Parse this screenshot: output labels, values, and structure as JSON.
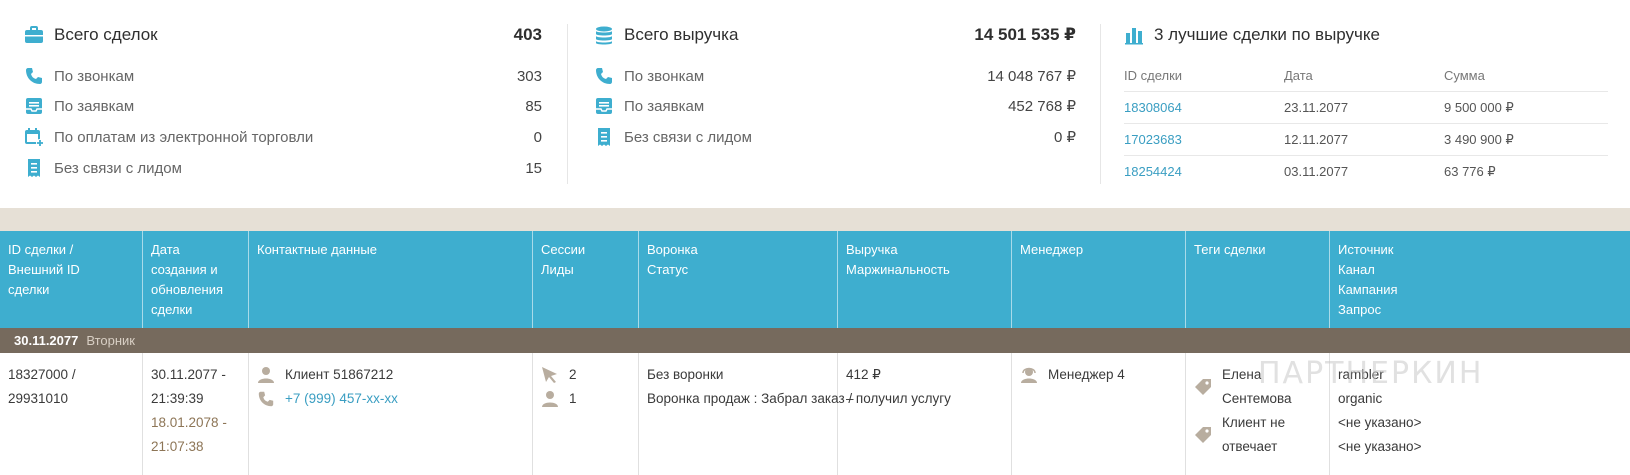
{
  "colors": {
    "accent": "#3eaecf",
    "group_band": "#766a5d",
    "link": "#3a9ec2",
    "icon": "#3eaecf",
    "icon_muted": "#b8ad9f"
  },
  "summary_deals": {
    "title": "Всего сделок",
    "total": "403",
    "icon": "briefcase-icon",
    "rows": [
      {
        "label": "По звонкам",
        "value": "303",
        "icon": "phone-icon"
      },
      {
        "label": "По заявкам",
        "value": "85",
        "icon": "inbox-icon"
      },
      {
        "label": "По оплатам из электронной торговли",
        "value": "0",
        "icon": "calendar-add-icon"
      },
      {
        "label": "Без связи с лидом",
        "value": "15",
        "icon": "receipt-icon"
      }
    ]
  },
  "summary_revenue": {
    "title": "Всего выручка",
    "total": "14 501 535 ₽",
    "icon": "coins-icon",
    "rows": [
      {
        "label": "По звонкам",
        "value": "14 048 767 ₽",
        "icon": "phone-icon"
      },
      {
        "label": "По заявкам",
        "value": "452 768 ₽",
        "icon": "inbox-icon"
      },
      {
        "label": "Без связи с лидом",
        "value": "0 ₽",
        "icon": "receipt-icon"
      }
    ]
  },
  "top3": {
    "title": "3 лучшие сделки по выручке",
    "icon": "bar-chart-icon",
    "headers": {
      "id": "ID сделки",
      "date": "Дата",
      "sum": "Сумма"
    },
    "rows": [
      {
        "id": "18308064",
        "date": "23.11.2077",
        "sum": "9 500 000 ₽"
      },
      {
        "id": "17023683",
        "date": "12.11.2077",
        "sum": "3 490 900 ₽"
      },
      {
        "id": "18254424",
        "date": "03.11.2077",
        "sum": "63 776 ₽"
      }
    ]
  },
  "table": {
    "headers": [
      [
        "ID сделки /",
        "Внешний ID",
        "сделки"
      ],
      [
        "Дата",
        "создания и",
        "обновления",
        "сделки"
      ],
      [
        "Контактные данные"
      ],
      [
        "Сессии",
        "Лиды"
      ],
      [
        "Воронка",
        "Статус"
      ],
      [
        "Выручка",
        "Маржинальность"
      ],
      [
        "Менеджер"
      ],
      [
        "Теги сделки"
      ],
      [
        "Источник",
        "Канал",
        "Кампания",
        "Запрос"
      ]
    ],
    "group": {
      "date": "30.11.2077",
      "weekday": "Вторник"
    },
    "row": {
      "id_lines": [
        "18327000 /",
        "29931010"
      ],
      "created": [
        "30.11.2077 -",
        "21:39:39"
      ],
      "updated": [
        "18.01.2078 -",
        "21:07:38"
      ],
      "contact_name": "Клиент 51867212",
      "contact_phone": "+7 (999) 457-xx-xx",
      "sessions": "2",
      "leads": "1",
      "funnel": "Без воронки",
      "status": "Воронка продаж : Забрал заказ / получил услугу",
      "revenue": "412 ₽",
      "margin": "–",
      "manager": "Менеджер 4",
      "tags": [
        "Елена Сентемова",
        "Клиент не отвечает"
      ],
      "source": [
        "rambler",
        "organic",
        "<не указано>",
        "<не указано>"
      ]
    }
  },
  "watermark": "ПАРТНЕРКИН"
}
